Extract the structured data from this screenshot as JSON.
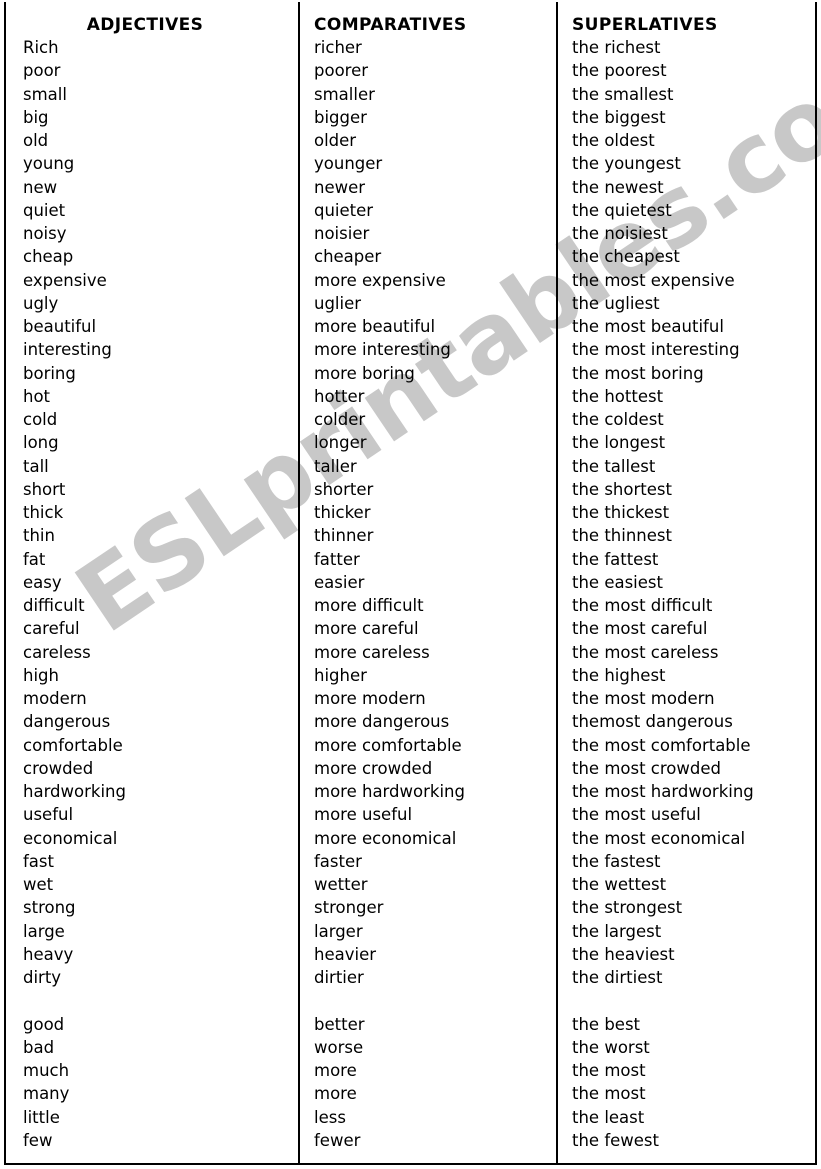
{
  "worksheet": {
    "watermark": "ESLprintables.com",
    "watermark_color": "#c8c8c8",
    "text_color": "#000000",
    "background_color": "#ffffff",
    "border_color": "#000000"
  },
  "columns": {
    "adjectives": {
      "header": "ADJECTIVES",
      "words": [
        "Rich",
        "poor",
        "small",
        "big",
        "old",
        "young",
        "new",
        "quiet",
        "noisy",
        "cheap",
        "expensive",
        "ugly",
        "beautiful",
        "interesting",
        "boring",
        "hot",
        "cold",
        "long",
        "tall",
        "short",
        "thick",
        "thin",
        "fat",
        "easy",
        "difficult",
        "careful",
        "careless",
        "high",
        "modern",
        "dangerous",
        "comfortable",
        "crowded",
        "hardworking",
        "useful",
        "economical",
        "fast",
        "wet",
        "strong",
        "large",
        "heavy",
        "dirty",
        "",
        "good",
        "bad",
        "much",
        "many",
        "little",
        "few"
      ]
    },
    "comparatives": {
      "header": "COMPARATIVES",
      "words": [
        "richer",
        "poorer",
        "smaller",
        "bigger",
        "older",
        "younger",
        "newer",
        "quieter",
        "noisier",
        "cheaper",
        "more expensive",
        "uglier",
        "more beautiful",
        "more interesting",
        "more boring",
        "hotter",
        "colder",
        "longer",
        "taller",
        "shorter",
        "thicker",
        "thinner",
        "fatter",
        "easier",
        "more difficult",
        "more careful",
        "more careless",
        "higher",
        "more modern",
        "more dangerous",
        "more comfortable",
        "more crowded",
        "more hardworking",
        "more useful",
        "more economical",
        "faster",
        "wetter",
        "stronger",
        "larger",
        "heavier",
        "dirtier",
        "",
        "better",
        "worse",
        "more",
        "more",
        "less",
        "fewer"
      ]
    },
    "superlatives": {
      "header": "SUPERLATIVES",
      "words": [
        "the richest",
        "the poorest",
        "the smallest",
        "the biggest",
        "the oldest",
        "the youngest",
        "the newest",
        "the quietest",
        "the noisiest",
        "the cheapest",
        "the most expensive",
        "the ugliest",
        "the most beautiful",
        "the most interesting",
        "the most boring",
        "the hottest",
        "the coldest",
        "the longest",
        "the tallest",
        "the shortest",
        "the thickest",
        "the thinnest",
        "the fattest",
        "the easiest",
        "the most difficult",
        "the most careful",
        "the most careless",
        "the highest",
        "the most modern",
        "themost dangerous",
        "the most comfortable",
        "the most crowded",
        "the most hardworking",
        "the most useful",
        "the most economical",
        "the fastest",
        "the wettest",
        "the strongest",
        "the largest",
        "the heaviest",
        "the dirtiest",
        "",
        "the best",
        "the worst",
        "the most",
        "the most",
        "the least",
        "the fewest"
      ]
    }
  }
}
